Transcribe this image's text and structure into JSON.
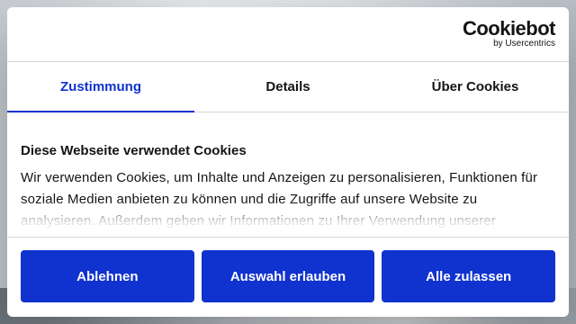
{
  "brand": {
    "name": "Cookiebot",
    "sub": "by Usercentrics"
  },
  "tabs": [
    {
      "label": "Zustimmung",
      "active": true
    },
    {
      "label": "Details",
      "active": false
    },
    {
      "label": "Über Cookies",
      "active": false
    }
  ],
  "content": {
    "title": "Diese Webseite verwendet Cookies",
    "text": "Wir verwenden Cookies, um Inhalte und Anzeigen zu personalisieren, Funktionen für soziale Medien anbieten zu können und die Zugriffe auf unsere Website zu analysieren. Außerdem geben wir Informationen zu Ihrer Verwendung unserer"
  },
  "buttons": {
    "decline": "Ablehnen",
    "allow_selection": "Auswahl erlauben",
    "allow_all": "Alle zulassen"
  },
  "colors": {
    "accent": "#1032cf",
    "text": "#141414",
    "divider": "#d6d6d6"
  }
}
